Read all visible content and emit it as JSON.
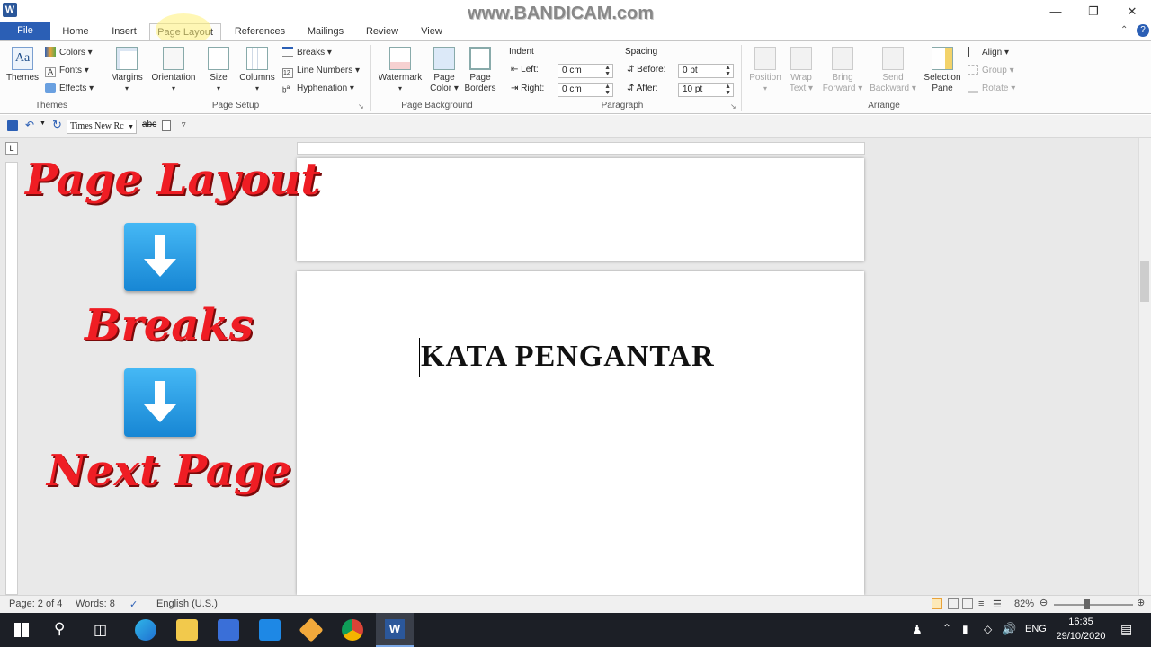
{
  "watermark": "www.BANDICAM.com",
  "tabs": {
    "file": "File",
    "items": [
      "Home",
      "Insert",
      "Page Layout",
      "References",
      "Mailings",
      "Review",
      "View"
    ]
  },
  "ribbon": {
    "themes": {
      "themes_label": "Themes",
      "colors": "Colors",
      "fonts": "Fonts",
      "effects": "Effects",
      "group": "Themes"
    },
    "page_setup": {
      "margins": "Margins",
      "orientation": "Orientation",
      "size": "Size",
      "columns": "Columns",
      "breaks": "Breaks",
      "line_numbers": "Line Numbers",
      "hyphenation": "Hyphenation",
      "group": "Page Setup"
    },
    "page_background": {
      "watermark": "Watermark",
      "page_color_1": "Page",
      "page_color_2": "Color",
      "page_borders_1": "Page",
      "page_borders_2": "Borders",
      "group": "Page Background"
    },
    "paragraph": {
      "indent": "Indent",
      "left_label": "Left:",
      "left_value": "0 cm",
      "right_label": "Right:",
      "right_value": "0 cm",
      "spacing": "Spacing",
      "before_label": "Before:",
      "before_value": "0 pt",
      "after_label": "After:",
      "after_value": "10 pt",
      "group": "Paragraph"
    },
    "arrange": {
      "position": "Position",
      "wrap_1": "Wrap",
      "wrap_2": "Text",
      "bring_1": "Bring",
      "bring_2": "Forward",
      "send_1": "Send",
      "send_2": "Backward",
      "sel_1": "Selection",
      "sel_2": "Pane",
      "align": "Align",
      "group_btn": "Group",
      "rotate": "Rotate",
      "group": "Arrange"
    }
  },
  "qat": {
    "font": "Times New Rc"
  },
  "document": {
    "heading": "KATA PENGANTAR"
  },
  "overlay": {
    "line1": "Page Layout",
    "line2": "Breaks",
    "line3": "Next Page"
  },
  "status": {
    "page": "Page: 2 of 4",
    "words": "Words: 8",
    "language": "English (U.S.)",
    "zoom": "82%"
  },
  "taskbar": {
    "lang": "ENG",
    "time": "16:35",
    "date": "29/10/2020"
  },
  "colors": {
    "accent": "#2b5fb5",
    "overlay_text": "#ef1d24",
    "arrow": "#1e8fe0"
  }
}
